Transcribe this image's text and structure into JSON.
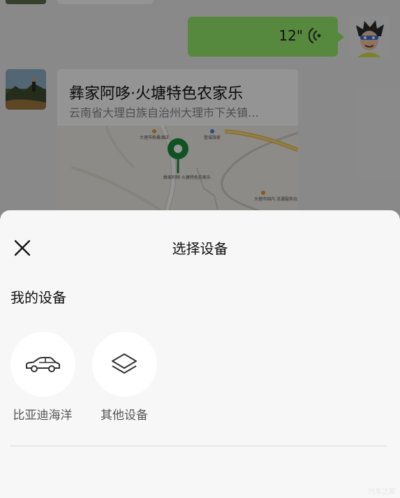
{
  "chat": {
    "voice_message": {
      "duration": "12\""
    },
    "location_message": {
      "title": "彝家阿哆·火塘特色农家乐",
      "address": "云南省大理白族自治州大理市下关镇…",
      "map_labels": {
        "poi_1": "大理市粉桑酒店",
        "poi_2": "登城驿家",
        "pin": "彝家阿哆·火塘特色农家乐",
        "poi_3": "大理市国内\n流通服务站"
      }
    }
  },
  "sheet": {
    "title": "选择设备",
    "section_label": "我的设备",
    "devices": [
      {
        "label": "比亚迪海洋",
        "icon": "car-icon"
      },
      {
        "label": "其他设备",
        "icon": "layers-icon"
      }
    ]
  },
  "watermark": "汽车之家",
  "colors": {
    "voice_bubble": "#95ec69",
    "map_pin": "#1a8f3c",
    "sheet_bg": "#f7f7f7"
  }
}
